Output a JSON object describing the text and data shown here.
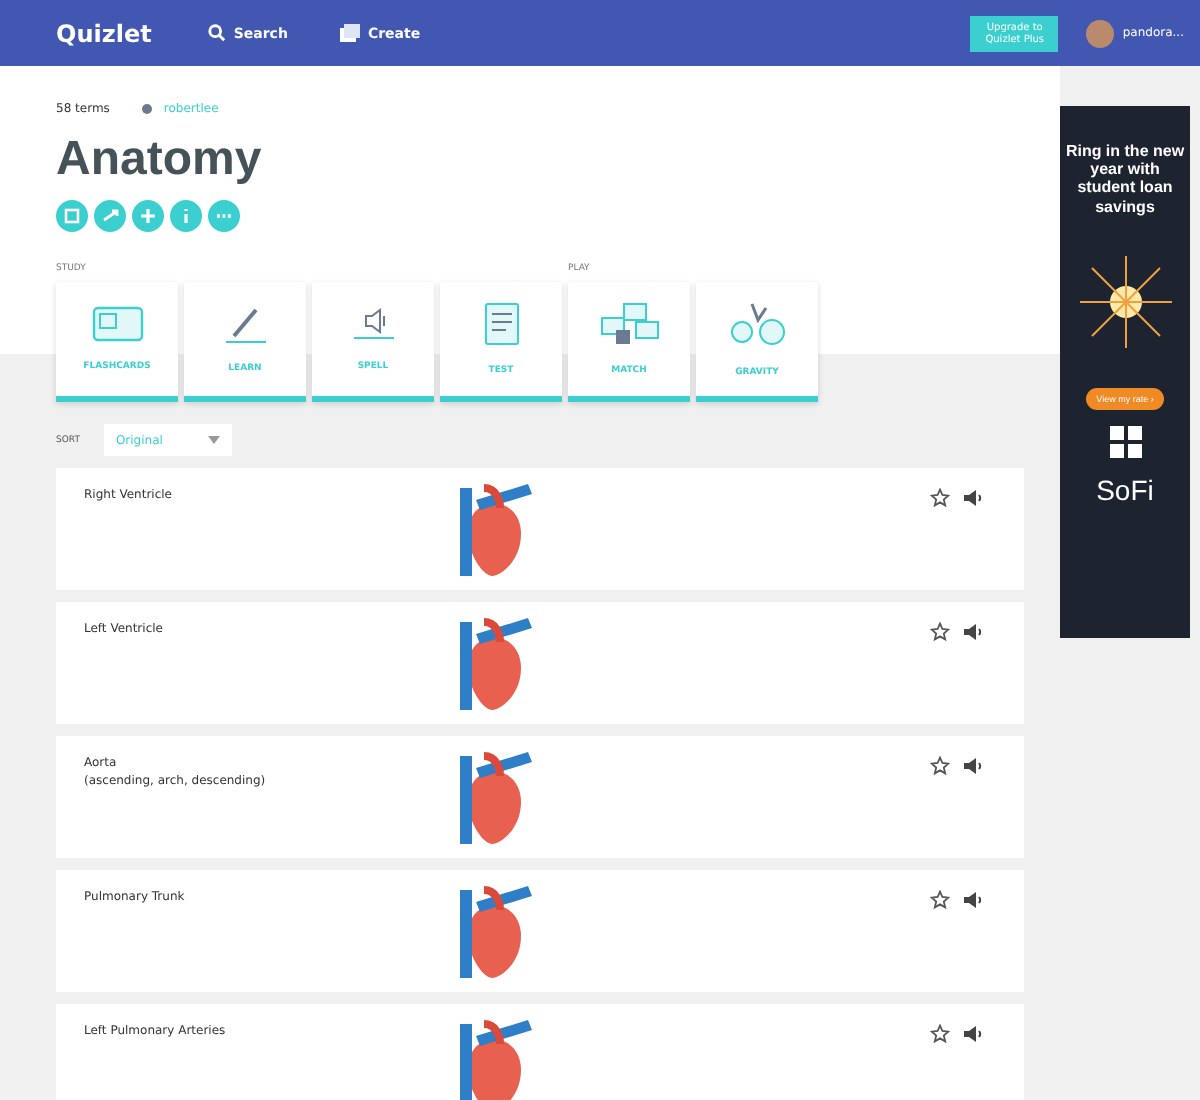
{
  "header": {
    "logo": "Quizlet",
    "nav": [
      {
        "kind": "search",
        "label": "Search"
      },
      {
        "kind": "create",
        "label": "Create"
      }
    ],
    "upgrade": "Upgrade to Quizlet Plus",
    "user": "pandora..."
  },
  "set": {
    "terms": "58 terms",
    "creator": "robertlee",
    "title": "Anatomy"
  },
  "study": {
    "label": "STUDY",
    "modes": [
      {
        "kind": "flashcards",
        "label": "FLASHCARDS"
      },
      {
        "kind": "learn",
        "label": "LEARN"
      },
      {
        "kind": "spell",
        "label": "SPELL"
      },
      {
        "kind": "test",
        "label": "TEST"
      }
    ]
  },
  "play": {
    "label": "PLAY",
    "modes": [
      {
        "kind": "match",
        "label": "MATCH"
      },
      {
        "kind": "gravity",
        "label": "GRAVITY"
      }
    ]
  },
  "sort": {
    "label": "SORT",
    "value": "Original"
  },
  "terms": [
    {
      "lines": [
        "Right Ventricle"
      ]
    },
    {
      "lines": [
        "Left Ventricle"
      ]
    },
    {
      "lines": [
        "Aorta",
        "(ascending, arch, descending)"
      ]
    },
    {
      "lines": [
        "Pulmonary Trunk"
      ]
    },
    {
      "lines": [
        "Left Pulmonary Arteries"
      ]
    }
  ],
  "ad": {
    "headline": "Ring in the new year with student loan savings",
    "button": "View my rate ›",
    "brand": "SoFi"
  }
}
